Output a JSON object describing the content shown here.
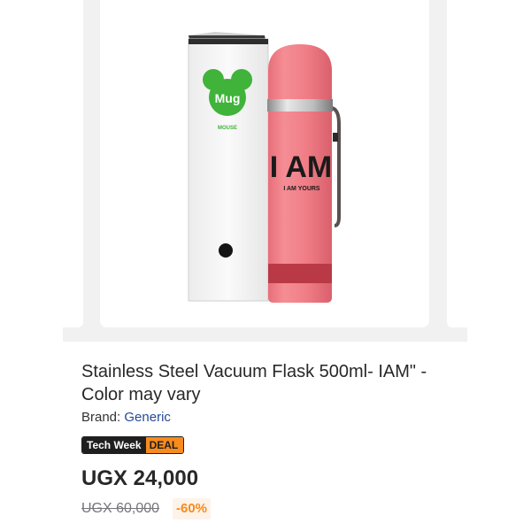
{
  "product": {
    "title": "Stainless Steel Vacuum Flask 500ml- IAM\" - Color may vary",
    "brand_label": "Brand:",
    "brand_name": "Generic",
    "badge": {
      "left": "Tech Week",
      "right": "DEAL"
    },
    "price": "UGX 24,000",
    "old_price": "UGX 60,000",
    "discount": "-60%"
  },
  "image": {
    "box_logo_text": "Mug",
    "box_sub_text": "MOUSE",
    "flask_big_text": "I AM",
    "flask_small_text": "I AM YOURS",
    "colors": {
      "flask": "#f07d86",
      "flask_band": "#b93a46",
      "logo_green": "#3fb33a",
      "box": "#f6f6f6"
    }
  },
  "colors": {
    "accent": "#f68b1e",
    "brand_link": "#264996",
    "text": "#282828",
    "muted": "#75757a"
  }
}
